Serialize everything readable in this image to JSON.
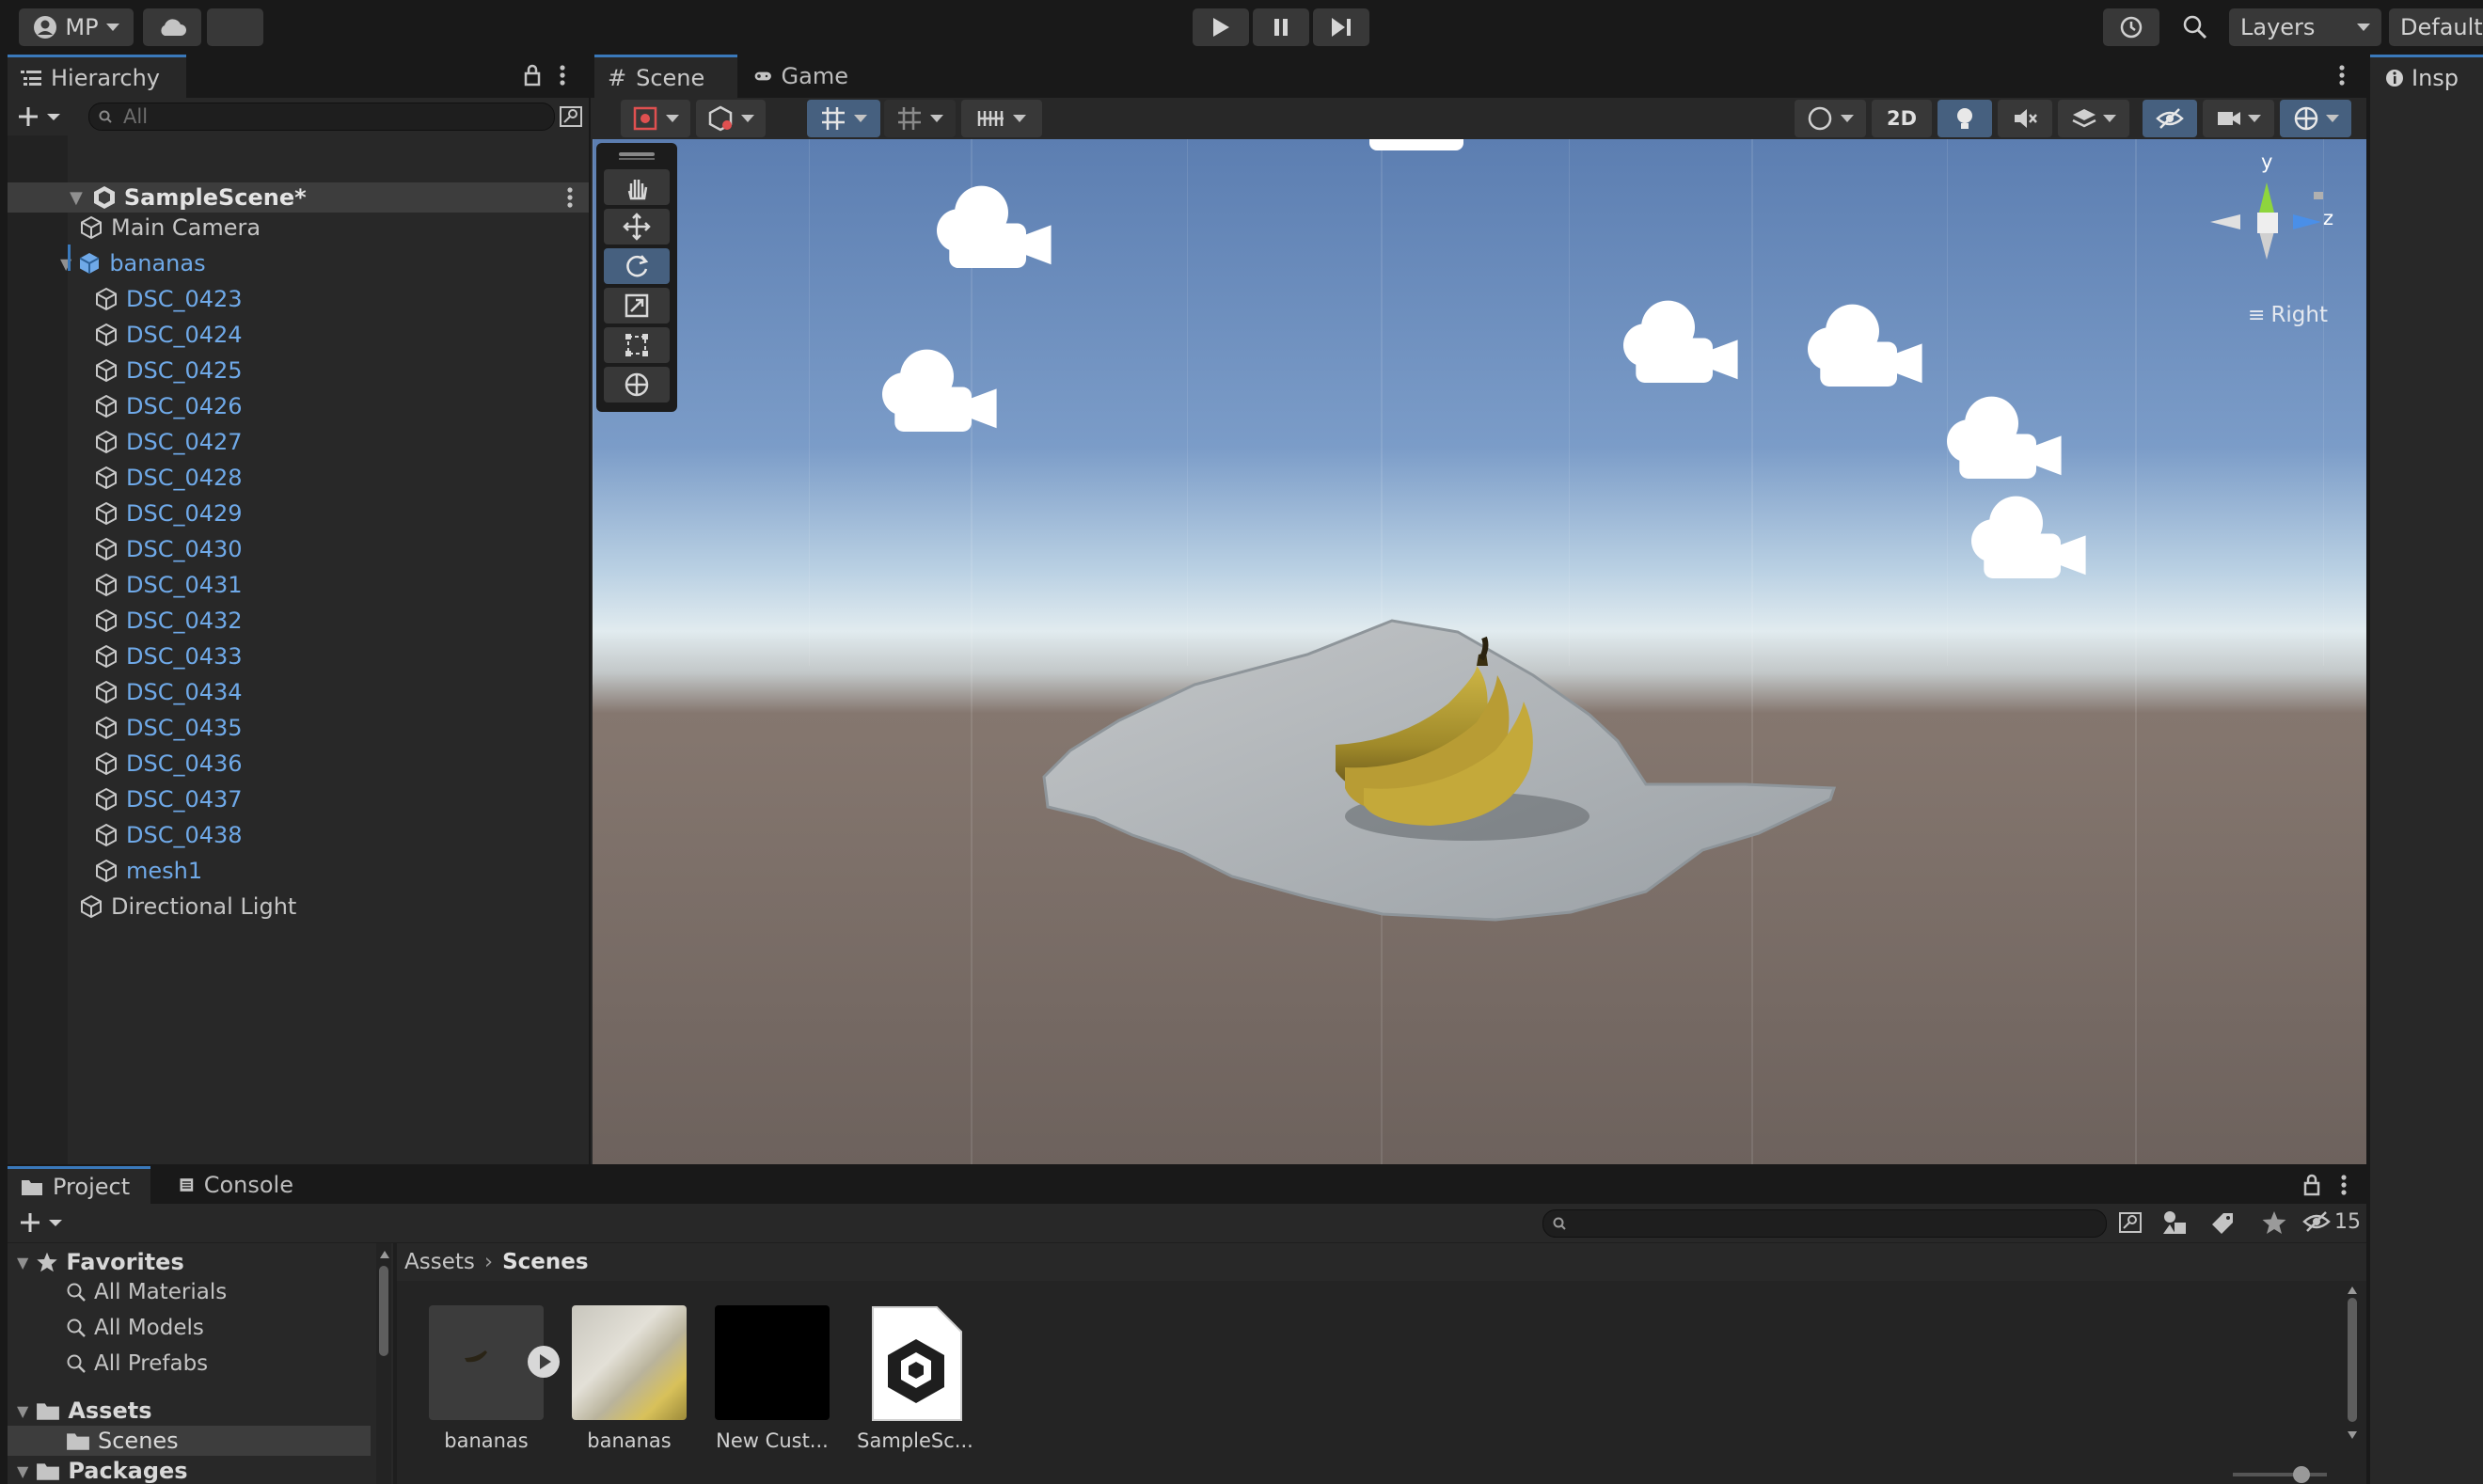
{
  "toolbar": {
    "account_label": "MP",
    "layers_label": "Layers",
    "layout_label": "Default"
  },
  "hierarchy": {
    "tab_label": "Hierarchy",
    "search_placeholder": "All",
    "scene_name": "SampleScene*",
    "items": [
      {
        "label": "Main Camera",
        "depth": 1,
        "blue": false
      },
      {
        "label": "bananas",
        "depth": 1,
        "blue": true
      },
      {
        "label": "DSC_0423",
        "depth": 2,
        "blue": true
      },
      {
        "label": "DSC_0424",
        "depth": 2,
        "blue": true
      },
      {
        "label": "DSC_0425",
        "depth": 2,
        "blue": true
      },
      {
        "label": "DSC_0426",
        "depth": 2,
        "blue": true
      },
      {
        "label": "DSC_0427",
        "depth": 2,
        "blue": true
      },
      {
        "label": "DSC_0428",
        "depth": 2,
        "blue": true
      },
      {
        "label": "DSC_0429",
        "depth": 2,
        "blue": true
      },
      {
        "label": "DSC_0430",
        "depth": 2,
        "blue": true
      },
      {
        "label": "DSC_0431",
        "depth": 2,
        "blue": true
      },
      {
        "label": "DSC_0432",
        "depth": 2,
        "blue": true
      },
      {
        "label": "DSC_0433",
        "depth": 2,
        "blue": true
      },
      {
        "label": "DSC_0434",
        "depth": 2,
        "blue": true
      },
      {
        "label": "DSC_0435",
        "depth": 2,
        "blue": true
      },
      {
        "label": "DSC_0436",
        "depth": 2,
        "blue": true
      },
      {
        "label": "DSC_0437",
        "depth": 2,
        "blue": true
      },
      {
        "label": "DSC_0438",
        "depth": 2,
        "blue": true
      },
      {
        "label": "mesh1",
        "depth": 2,
        "blue": true
      },
      {
        "label": "Directional Light",
        "depth": 1,
        "blue": false
      }
    ]
  },
  "scene": {
    "tabs": [
      {
        "label": "Scene"
      },
      {
        "label": "Game"
      }
    ],
    "mode_2d_label": "2D",
    "gizmo": {
      "y_label": "y",
      "z_label": "z",
      "view_label": "Right"
    }
  },
  "inspector": {
    "tab_label": "Insp"
  },
  "project": {
    "tabs": [
      {
        "label": "Project"
      },
      {
        "label": "Console"
      }
    ],
    "hidden_count": "15",
    "favorites_label": "Favorites",
    "favorites": [
      "All Materials",
      "All Models",
      "All Prefabs"
    ],
    "assets_label": "Assets",
    "scenes_label": "Scenes",
    "packages_label": "Packages",
    "breadcrumb": [
      "Assets",
      "Scenes"
    ],
    "assets": [
      {
        "label": "bananas",
        "kind": "model"
      },
      {
        "label": "bananas",
        "kind": "texture"
      },
      {
        "label": "New Cust...",
        "kind": "material"
      },
      {
        "label": "SampleSc...",
        "kind": "scene"
      }
    ]
  }
}
